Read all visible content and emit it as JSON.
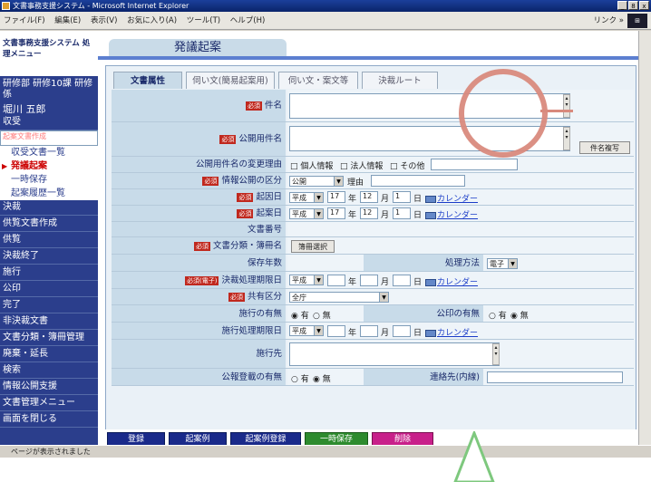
{
  "window": {
    "title": "文書事務支援システム - Microsoft Internet Explorer",
    "buttons": [
      "_",
      "8",
      "x"
    ]
  },
  "menubar": {
    "items": [
      "ファイル(F)",
      "編集(E)",
      "表示(V)",
      "お気に入り(A)",
      "ツール(T)",
      "ヘルプ(H)"
    ],
    "links_label": "リンク »"
  },
  "sidebar": {
    "system_title": "文書事務支援システム 処理メニュー",
    "department": "研修部 研修10課 研修係",
    "user_name": "堀川 五郎",
    "items": [
      {
        "label": "収受"
      },
      {
        "label": "起案文書作成",
        "selected": true
      },
      {
        "label": "収受文書一覧",
        "sub": true
      },
      {
        "label": "発議起案",
        "sub": true,
        "current": true
      },
      {
        "label": "一時保存",
        "sub": true
      },
      {
        "label": "起案履歴一覧",
        "sub": true
      },
      {
        "label": "決裁"
      },
      {
        "label": "供覧文書作成"
      },
      {
        "label": "供覧"
      },
      {
        "label": "決裁終了"
      },
      {
        "label": "施行"
      },
      {
        "label": "公印"
      },
      {
        "label": "完了"
      },
      {
        "label": "非決裁文書"
      },
      {
        "label": "文書分類・簿冊管理"
      },
      {
        "label": "廃棄・延長"
      },
      {
        "label": "検索"
      },
      {
        "label": "情報公開支援"
      },
      {
        "label": "文書管理メニュー"
      },
      {
        "label": "画面を閉じる"
      }
    ]
  },
  "page": {
    "title": "発議起案",
    "tabs": [
      "文書属性",
      "伺い文(簡易起案用)",
      "伺い文・案文等",
      "決裁ルート"
    ],
    "required_badge": "必須",
    "required_badge_elec": "必須(電子)"
  },
  "form": {
    "subject_label": "件名",
    "public_subject_label": "公開用件名",
    "subject_copy_button": "件名複写",
    "change_reason_label": "公開用件名の変更理由",
    "change_reason_options": [
      "個人情報",
      "法人情報",
      "その他"
    ],
    "disclosure_label": "情報公開の区分",
    "disclosure_value": "公開",
    "reason_label": "理由",
    "origin_date_label": "起因日",
    "draft_date_label": "起案日",
    "era": "平成",
    "year_value": "17",
    "month_value": "12",
    "day_value": "1",
    "year_unit": "年",
    "month_unit": "月",
    "day_unit": "日",
    "calendar_link": "カレンダー",
    "doc_number_label": "文書番号",
    "classification_label": "文書分類・簿冊名",
    "ledger_select_button": "簿冊選択",
    "retention_label": "保存年数",
    "process_method_label": "処理方法",
    "process_method_value": "電子",
    "deadline_label": "決裁処理期限日",
    "sharing_label": "共有区分",
    "sharing_value": "全庁",
    "enforcement_label": "施行の有無",
    "yes": "有",
    "no": "無",
    "seal_label": "公印の有無",
    "enforcement_deadline_label": "施行処理期限日",
    "destination_label": "施行先",
    "bulletin_label": "公報登載の有無",
    "contact_label": "連絡先(内線)"
  },
  "footer_buttons": [
    {
      "label": "登録",
      "color": "#1a2a8a"
    },
    {
      "label": "起案例",
      "color": "#1a2a8a"
    },
    {
      "label": "起案例登録",
      "color": "#1a2a8a"
    },
    {
      "label": "一時保存",
      "color": "#2e8b2e"
    },
    {
      "label": "削除",
      "color": "#c8208a"
    }
  ],
  "status": {
    "text": "ページが表示されました"
  },
  "colors": {
    "sidebar_bg": "#2b3e8c",
    "label_bg": "#c8dbe9",
    "required": "#c0281e",
    "highlight_circle": "#d98a7d"
  }
}
